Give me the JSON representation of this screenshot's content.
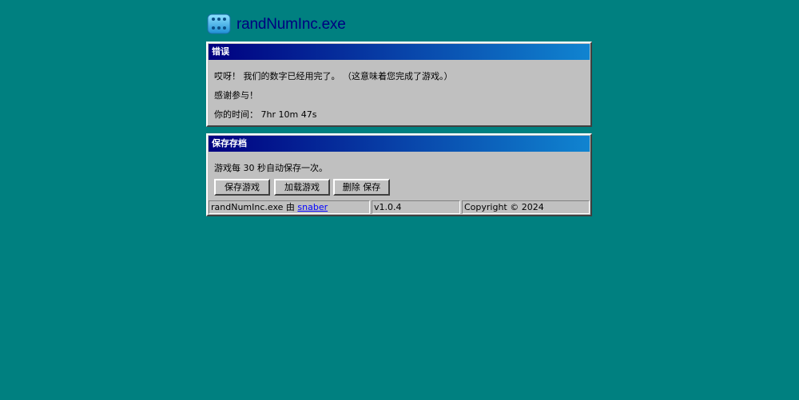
{
  "header": {
    "app_name": "randNumInc.exe",
    "icon": "dice-icon"
  },
  "error_window": {
    "title": "错误",
    "line1": "哎呀！ 我们的数字已经用完了。 （这意味着您完成了游戏。）",
    "line2": "感谢参与！",
    "time_label": "你的时间：",
    "time_value": "7hr 10m 47s"
  },
  "save_window": {
    "title": "保存存档",
    "autosave_text": "游戏每 30 秒自动保存一次。",
    "buttons": {
      "save": "保存游戏",
      "load": "加载游戏",
      "delete": "删除 保存"
    }
  },
  "statusbar": {
    "credit_prefix": "randNumInc.exe 由",
    "author": "snaber",
    "version": "v1.0.4",
    "copyright": "Copyright © 2024"
  },
  "colors": {
    "desktop": "#008080",
    "titlebar_start": "#000080",
    "titlebar_end": "#1084d0",
    "window_face": "#c0c0c0",
    "link": "#0000ff"
  }
}
